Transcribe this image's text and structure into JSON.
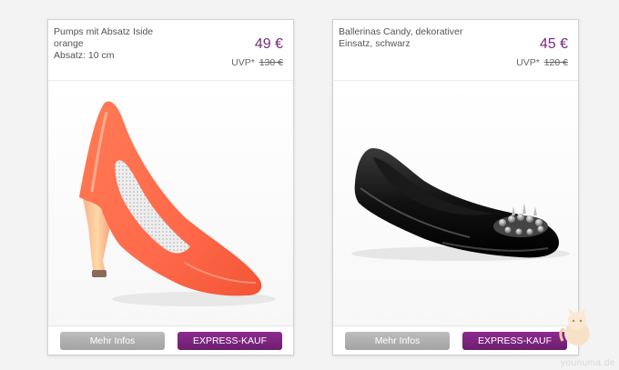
{
  "products": [
    {
      "title_lines": [
        "Pumps mit Absatz Iside",
        "orange",
        "Absatz: 10 cm"
      ],
      "price": "49 €",
      "uvp_label": "UVP*",
      "uvp_price": "130 €",
      "image": "orange-pump-shoe",
      "more_label": "Mehr Infos",
      "express_label": "EXPRESS-KAUF"
    },
    {
      "title_lines": [
        "Ballerinas Candy, dekorativer",
        "Einsatz, schwarz"
      ],
      "price": "45 €",
      "uvp_label": "UVP*",
      "uvp_price": "120 €",
      "image": "black-ballerina-shoe",
      "more_label": "Mehr Infos",
      "express_label": "EXPRESS-KAUF"
    }
  ],
  "watermark": "younuma.de",
  "colors": {
    "price": "#7a2a7c",
    "express_button": "#7a237c",
    "more_button": "#b0b0b0"
  }
}
